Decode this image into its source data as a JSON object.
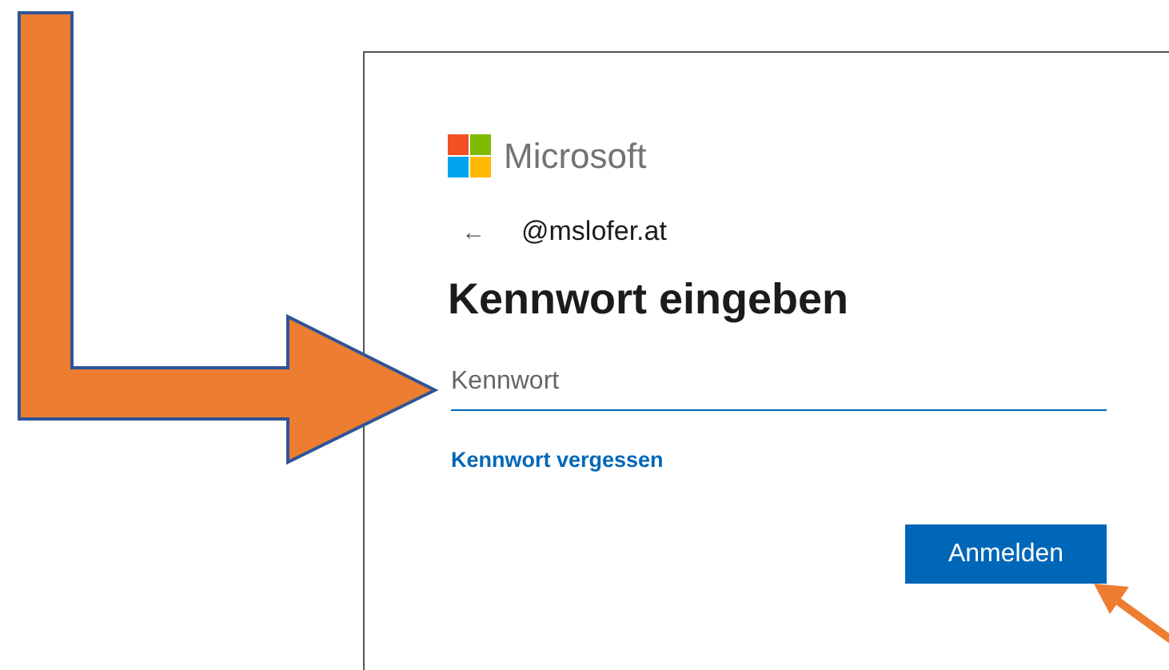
{
  "logo": {
    "text": "Microsoft"
  },
  "account": {
    "back": "←",
    "email": "@mslofer.at"
  },
  "heading": "Kennwort eingeben",
  "password_field": {
    "placeholder": "Kennwort"
  },
  "forgot_link": "Kennwort vergessen",
  "submit_button": "Anmelden"
}
